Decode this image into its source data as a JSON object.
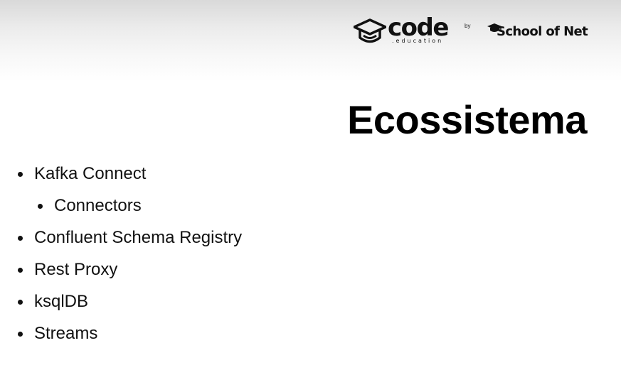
{
  "header": {
    "code_logo": {
      "word": "code",
      "sub": ".education",
      "icon": "graduation-cap-icon"
    },
    "by_text": "by",
    "partner_logo": {
      "text": "School of Net",
      "icon": "graduation-cap-icon"
    }
  },
  "slide": {
    "title": "Ecossistema",
    "bullets": [
      {
        "text": "Kafka Connect",
        "level": 1
      },
      {
        "text": "Connectors",
        "level": 2
      },
      {
        "text": "Confluent Schema Registry",
        "level": 1
      },
      {
        "text": "Rest Proxy",
        "level": 1
      },
      {
        "text": "ksqlDB",
        "level": 1
      },
      {
        "text": "Streams",
        "level": 1
      }
    ]
  },
  "colors": {
    "text": "#111111",
    "background": "#ffffff",
    "header_gradient_top": "#d9d9d9"
  }
}
